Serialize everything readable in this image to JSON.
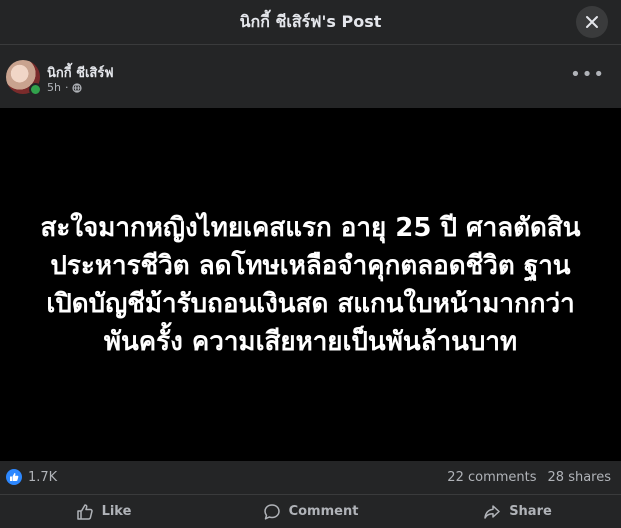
{
  "header": {
    "title": "นิกกี้ ชีเสิร์ฟ's Post"
  },
  "post": {
    "author": "นิกกี้ ชีเสิร์ฟ",
    "time": "5h",
    "privacy_icon": "globe-icon",
    "body_lines": [
      "สะใจมากหญิงไทยเคสแรก อายุ 25 ปี ศาลตัดสิน",
      "ประหารชีวิต ลดโทษเหลือจำคุกตลอดชีวิต ฐาน",
      "เปิดบัญชีม้ารับถอนเงินสด สแกนใบหน้ามากกว่า",
      "พันครั้ง ความเสียหายเป็นพันล้านบาท"
    ]
  },
  "stats": {
    "reactions": "1.7K",
    "comments": "22 comments",
    "shares": "28 shares"
  },
  "actions": {
    "like": "Like",
    "comment": "Comment",
    "share": "Share"
  },
  "colors": {
    "background": "#242526",
    "image_bg": "#000000",
    "accent": "#2d88ff",
    "online": "#31a24c"
  }
}
